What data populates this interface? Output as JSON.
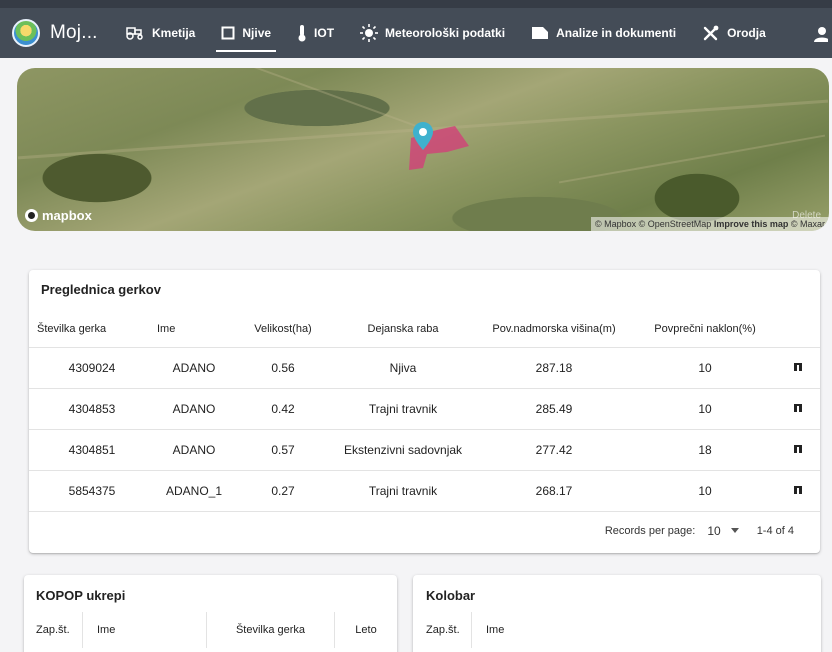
{
  "app": {
    "title": "Moj..."
  },
  "nav": [
    {
      "label": "Kmetija",
      "icon": "tractor-icon"
    },
    {
      "label": "Njive",
      "icon": "square-outline-icon",
      "active": true
    },
    {
      "label": "IOT",
      "icon": "thermometer-icon"
    },
    {
      "label": "Meteorološki podatki",
      "icon": "sun-icon"
    },
    {
      "label": "Analize in dokumenti",
      "icon": "document-icon"
    },
    {
      "label": "Orodja",
      "icon": "tools-icon"
    }
  ],
  "map": {
    "logo_text": "mapbox",
    "attrib_1": "© Mapbox © OpenStreetMap",
    "attrib_2": "Improve this map",
    "attrib_3": "© Maxar",
    "overlay_text": "Delete"
  },
  "gerki": {
    "title": "Preglednica gerkov",
    "headers": [
      "Številka gerka",
      "Ime",
      "Velikost(ha)",
      "Dejanska raba",
      "Pov.nadmorska višina(m)",
      "Povprečni naklon(%)"
    ],
    "rows": [
      [
        "4309024",
        "ADANO",
        "0.56",
        "Njiva",
        "287.18",
        "10"
      ],
      [
        "4304853",
        "ADANO",
        "0.42",
        "Trajni travnik",
        "285.49",
        "10"
      ],
      [
        "4304851",
        "ADANO",
        "0.57",
        "Ekstenzivni sadovnjak",
        "277.42",
        "18"
      ],
      [
        "5854375",
        "ADANO_1",
        "0.27",
        "Trajni travnik",
        "268.17",
        "10"
      ]
    ],
    "pager": {
      "label": "Records per page:",
      "value": "10",
      "range": "1-4 of 4"
    }
  },
  "kopop": {
    "title": "KOPOP ukrepi",
    "headers": [
      "Zap.št.",
      "Ime",
      "Številka gerka",
      "Leto"
    ]
  },
  "kolobar": {
    "title": "Kolobar",
    "headers": [
      "Zap.št.",
      "Ime"
    ]
  },
  "colors": {
    "appbar": "#444c57",
    "pin": "#3fb1ce",
    "parcel": "#d63a7a"
  }
}
